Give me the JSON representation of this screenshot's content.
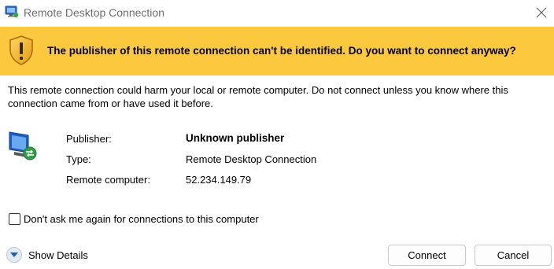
{
  "window": {
    "title": "Remote Desktop Connection",
    "app_icon": "remote-desktop-icon",
    "close_icon": "close-icon"
  },
  "banner": {
    "icon": "warning-shield-icon",
    "color": "#fcc93e",
    "message": "The publisher of this remote connection can't be identified. Do you want to connect anyway?"
  },
  "warning": {
    "text": "This remote connection could harm your local or remote computer. Do not connect unless you know where this connection came from or have used it before."
  },
  "details": {
    "icon": "remote-computer-icon",
    "publisher_label": "Publisher:",
    "publisher_value": "Unknown publisher",
    "type_label": "Type:",
    "type_value": "Remote Desktop Connection",
    "remote_label": "Remote computer:",
    "remote_value": "52.234.149.79"
  },
  "options": {
    "dont_ask_label": "Don't ask me again for connections to this computer",
    "dont_ask_checked": false
  },
  "footer": {
    "show_details_label": "Show Details",
    "connect_label": "Connect",
    "cancel_label": "Cancel"
  }
}
